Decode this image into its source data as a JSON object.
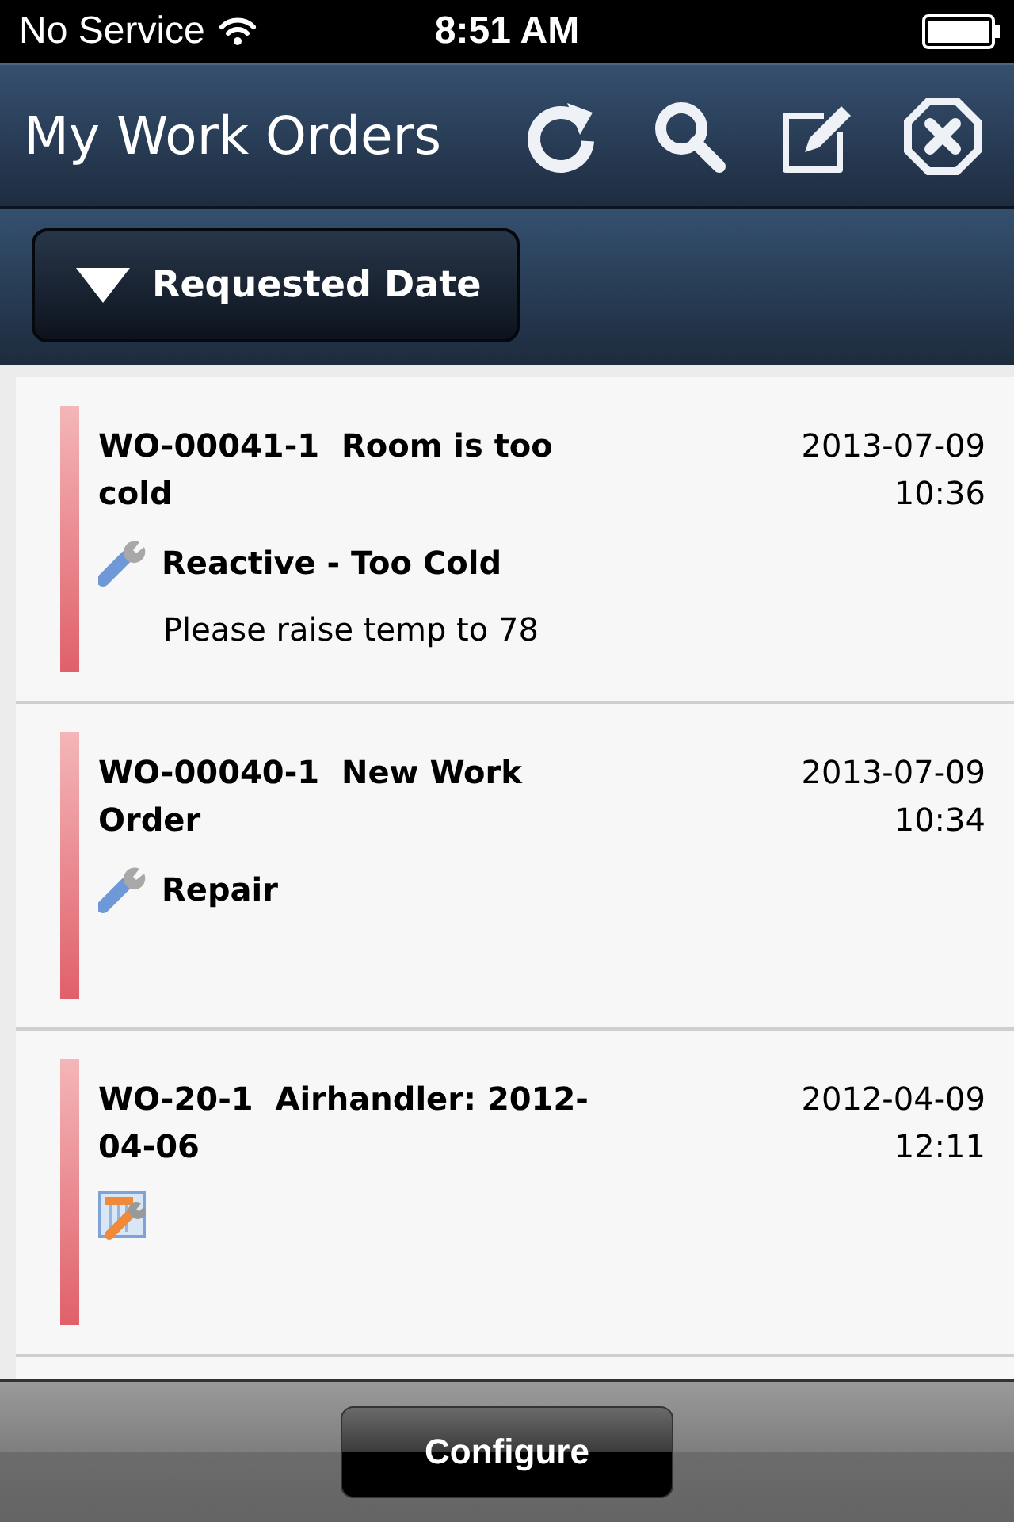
{
  "status_bar": {
    "carrier": "No Service",
    "time": "8:51 AM"
  },
  "header": {
    "title": "My Work Orders"
  },
  "sort": {
    "label": "Requested Date"
  },
  "orders": [
    {
      "code": "WO-00041-1",
      "title": "Room is too cold",
      "date": "2013-07-09",
      "time": "10:36",
      "kind": "wrench",
      "type": "Reactive - Too Cold",
      "description": "Please raise temp to 78"
    },
    {
      "code": "WO-00040-1",
      "title": "New Work Order",
      "date": "2013-07-09",
      "time": "10:34",
      "kind": "wrench",
      "type": "Repair"
    },
    {
      "code": "WO-20-1",
      "title": "Airhandler: 2012-04-06",
      "date": "2012-04-09",
      "time": "12:11",
      "kind": "equipment"
    }
  ],
  "footer": {
    "button": "Configure"
  }
}
